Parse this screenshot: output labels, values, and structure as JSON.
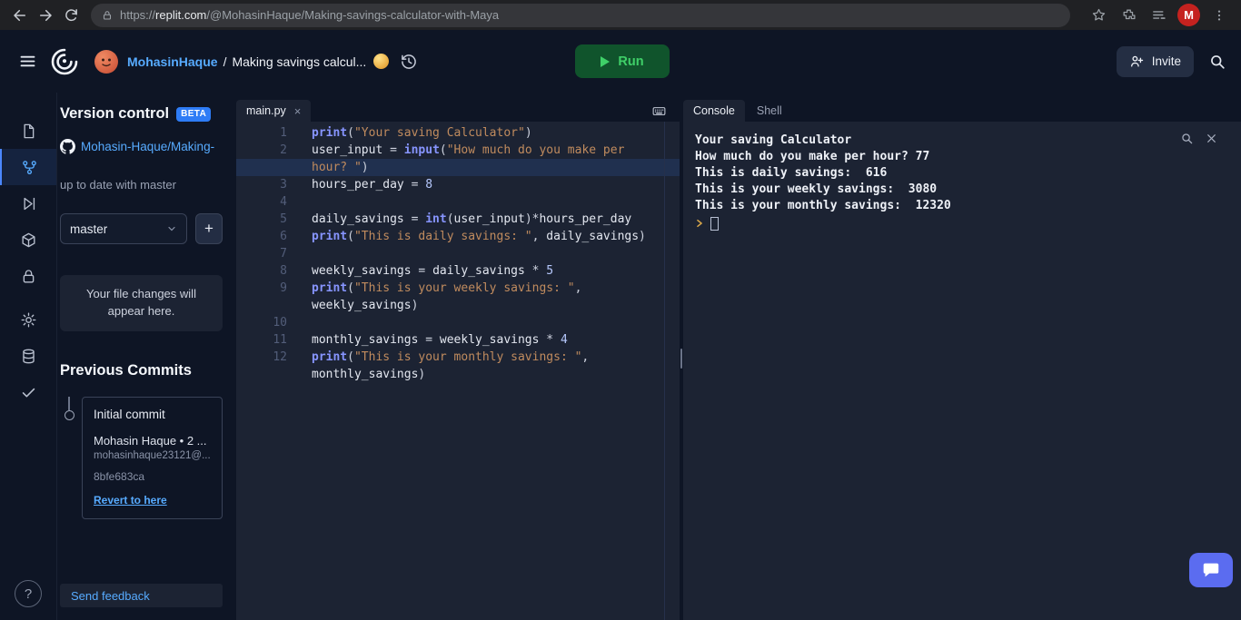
{
  "browser": {
    "url_scheme": "https://",
    "url_domain": "replit.com",
    "url_path": "/@MohasinHaque/Making-savings-calculator-with-Maya",
    "profile_initial": "M"
  },
  "header": {
    "user": "MohasinHaque",
    "separator": "/",
    "project": "Making savings calcul...",
    "run": "Run",
    "invite": "Invite"
  },
  "glyphs": {
    "close_tab": "×",
    "add_branch": "+",
    "help": "?"
  },
  "version_control": {
    "title": "Version control",
    "beta": "BETA",
    "repo": "Mohasin-Haque/Making-",
    "status": "up to date with master",
    "branch": "master",
    "empty_message": "Your file changes will appear here.",
    "commits_heading": "Previous Commits",
    "commit": {
      "message": "Initial commit",
      "author": "Mohasin Haque • 2 ...",
      "email": "mohasinhaque23121@...",
      "hash": "8bfe683ca",
      "revert_label": "Revert to here"
    },
    "feedback": "Send feedback"
  },
  "editor": {
    "tab": "main.py",
    "rows": [
      {
        "n": "1",
        "hl": false,
        "seg": [
          [
            "fn",
            "print"
          ],
          [
            "p",
            "("
          ],
          [
            "str",
            "\"Your saving Calculator\""
          ],
          [
            "p",
            ")"
          ]
        ]
      },
      {
        "n": "2",
        "hl": false,
        "seg": [
          [
            "var",
            "user_input"
          ],
          [
            "op",
            " = "
          ],
          [
            "fn",
            "input"
          ],
          [
            "p",
            "("
          ],
          [
            "str",
            "\"How much do you make per"
          ]
        ]
      },
      {
        "n": "",
        "hl": true,
        "seg": [
          [
            "str",
            "hour? \""
          ],
          [
            "p",
            ")"
          ]
        ]
      },
      {
        "n": "3",
        "hl": false,
        "seg": [
          [
            "var",
            "hours_per_day"
          ],
          [
            "op",
            " = "
          ],
          [
            "num",
            "8"
          ]
        ]
      },
      {
        "n": "4",
        "hl": false,
        "seg": []
      },
      {
        "n": "5",
        "hl": false,
        "seg": [
          [
            "var",
            "daily_savings"
          ],
          [
            "op",
            " = "
          ],
          [
            "fn",
            "int"
          ],
          [
            "p",
            "("
          ],
          [
            "var",
            "user_input"
          ],
          [
            "p",
            ")"
          ],
          [
            "op",
            "*"
          ],
          [
            "var",
            "hours_per_day"
          ]
        ]
      },
      {
        "n": "6",
        "hl": false,
        "seg": [
          [
            "fn",
            "print"
          ],
          [
            "p",
            "("
          ],
          [
            "str",
            "\"This is daily savings: \""
          ],
          [
            "p",
            ", "
          ],
          [
            "var",
            "daily_savings"
          ],
          [
            "p",
            ")"
          ]
        ]
      },
      {
        "n": "7",
        "hl": false,
        "seg": []
      },
      {
        "n": "8",
        "hl": false,
        "seg": [
          [
            "var",
            "weekly_savings"
          ],
          [
            "op",
            " = "
          ],
          [
            "var",
            "daily_savings"
          ],
          [
            "op",
            " * "
          ],
          [
            "num",
            "5"
          ]
        ]
      },
      {
        "n": "9",
        "hl": false,
        "seg": [
          [
            "fn",
            "print"
          ],
          [
            "p",
            "("
          ],
          [
            "str",
            "\"This is your weekly savings: \""
          ],
          [
            "p",
            ","
          ]
        ]
      },
      {
        "n": "",
        "hl": false,
        "seg": [
          [
            "var",
            "weekly_savings"
          ],
          [
            "p",
            ")"
          ]
        ]
      },
      {
        "n": "10",
        "hl": false,
        "seg": []
      },
      {
        "n": "11",
        "hl": false,
        "seg": [
          [
            "var",
            "monthly_savings"
          ],
          [
            "op",
            " = "
          ],
          [
            "var",
            "weekly_savings"
          ],
          [
            "op",
            " * "
          ],
          [
            "num",
            "4"
          ]
        ]
      },
      {
        "n": "12",
        "hl": false,
        "seg": [
          [
            "fn",
            "print"
          ],
          [
            "p",
            "("
          ],
          [
            "str",
            "\"This is your monthly savings: \""
          ],
          [
            "p",
            ","
          ]
        ]
      },
      {
        "n": "",
        "hl": false,
        "seg": [
          [
            "var",
            "monthly_savings"
          ],
          [
            "p",
            ")"
          ]
        ]
      }
    ]
  },
  "console": {
    "tabs": [
      "Console",
      "Shell"
    ],
    "active_tab": "Console",
    "lines": [
      "Your saving Calculator",
      "How much do you make per hour? 77",
      "This is daily savings:  616",
      "This is your weekly savings:  3080",
      "This is your monthly savings:  12320"
    ],
    "prompt": "❯"
  },
  "colors": {
    "background": "#0e1525",
    "panel": "#1c2333",
    "accent_blue": "#57abff",
    "run_button_bg": "#10542c",
    "run_button_text": "#3fcf68",
    "beta_badge": "#2e7cf6",
    "chat_fab": "#5b6cf0",
    "string_token": "#c08b5e",
    "function_token": "#8795ff",
    "line_highlight": "#20304f"
  },
  "icon_names": [
    "back-icon",
    "forward-icon",
    "reload-icon",
    "lock-icon",
    "star-icon",
    "extensions-icon",
    "reading-list-icon",
    "menu-kebab-icon",
    "hamburger-icon",
    "replit-logo",
    "user-avatar",
    "cycles-icon",
    "history-icon",
    "play-icon",
    "invite-person-icon",
    "search-icon",
    "files-icon",
    "version-control-icon",
    "run-icon",
    "packages-icon",
    "secrets-icon",
    "settings-icon",
    "database-icon",
    "checks-icon",
    "help-icon",
    "github-icon",
    "chevron-down-icon",
    "keyboard-icon",
    "console-search-icon",
    "console-clear-icon",
    "prompt-chevron-icon",
    "chat-icon"
  ]
}
